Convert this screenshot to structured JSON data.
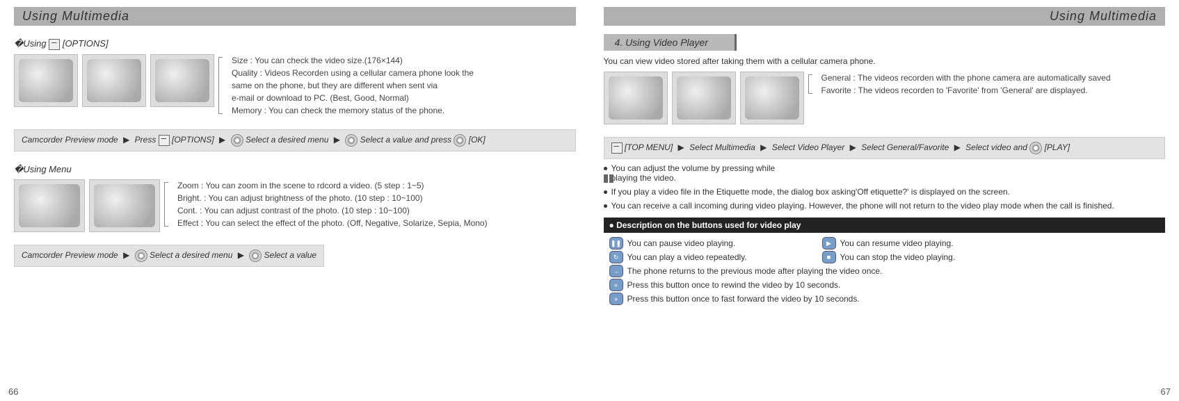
{
  "left": {
    "title": "Using Multimedia",
    "options_label": "�Using",
    "options_icon_label": "[OPTIONS]",
    "options_items": [
      "Size : You can check the video size.(176×144)",
      "Quality : Videos Recorden using a cellular camera phone look the",
      "          same on the phone, but they are different when sent via",
      "          e-mail or download to PC. (Best, Good, Normal)",
      "Memory : You can check the memory status of the phone."
    ],
    "bar1_pre": "Camcorder Preview mode",
    "bar1_press": "Press",
    "bar1_opt": "[OPTIONS]",
    "bar1_mid": "Select a desired menu",
    "bar1_end_pre": "Select a value and press",
    "bar1_ok": "[OK]",
    "menu_label": "�Using Menu",
    "menu_items": [
      "Zoom : You can zoom in the scene to rdcord a video. (5 step : 1~5)",
      "Bright. : You can adjust brightness of the photo. (10 step : 10~100)",
      "Cont. : You can adjust contrast of the photo. (10 step : 10~100)",
      "Effect : You can select the effect of the photo. (Off, Negative, Solarize, Sepia, Mono)"
    ],
    "bar2_pre": "Camcorder Preview mode",
    "bar2_mid": "Select a desired menu",
    "bar2_end": "Select a value",
    "page_num": "66"
  },
  "right": {
    "title": "Using Multimedia",
    "heading": "4. Using Video Player",
    "intro": "You can view video stored after taking them with a cellular camera phone.",
    "gen_fav": [
      "General : The videos recorden with the phone camera are automatically saved",
      "Favorite : The videos recorden to 'Favorite' from 'General' are displayed."
    ],
    "bar_top": "[TOP MENU]",
    "bar_b": "Select Multimedia",
    "bar_c": "Select Video Player",
    "bar_d": "Select General/Favorite",
    "bar_e": "Select video and",
    "bar_play": "[PLAY]",
    "bullets": [
      "You can adjust the volume by pressing      while playing the video.",
      "If you play a video file in the Etiquette mode, the dialog box asking'Off etiquette?' is displayed on the screen.",
      "You can receive a call incoming during video playing. However, the phone will not return to the video play mode when the call is finished."
    ],
    "desc_header": "Description on the buttons used for video play",
    "btns": {
      "pause": "You can pause video playing.",
      "resume": "You can resume video playing.",
      "repeat": "You can play a video repeatedly.",
      "stop": "You can stop the video playing.",
      "once": "The phone returns to the previous mode after playing the video once.",
      "rew": "Press this button once to rewind the video by 10 seconds.",
      "ff": "Press this button once to fast forward the video by 10 seconds."
    },
    "page_num": "67"
  }
}
